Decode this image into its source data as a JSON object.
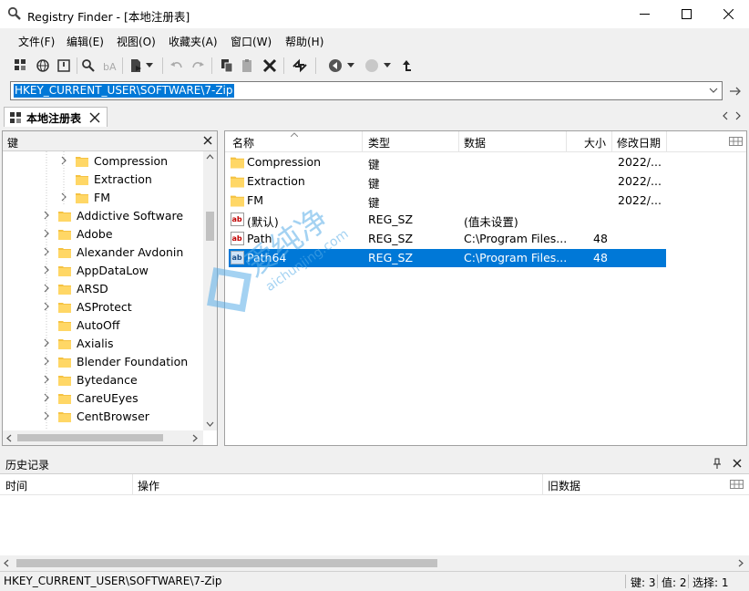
{
  "window": {
    "title": "Registry Finder - [本地注册表]"
  },
  "menu": [
    {
      "label": "文件(F)"
    },
    {
      "label": "编辑(E)"
    },
    {
      "label": "视图(O)"
    },
    {
      "label": "收藏夹(A)"
    },
    {
      "label": "窗口(W)"
    },
    {
      "label": "帮助(H)"
    }
  ],
  "address": {
    "value": "HKEY_CURRENT_USER\\SOFTWARE\\7-Zip"
  },
  "tabs": [
    {
      "label": "本地注册表"
    }
  ],
  "tree": {
    "header": "键",
    "items": [
      {
        "label": "Compression",
        "arrow": true
      },
      {
        "label": "Extraction",
        "arrow": false
      },
      {
        "label": "FM",
        "arrow": true
      },
      {
        "label": "Addictive Software",
        "arrow": true
      },
      {
        "label": "Adobe",
        "arrow": true
      },
      {
        "label": "Alexander Avdonin",
        "arrow": true
      },
      {
        "label": "AppDataLow",
        "arrow": true
      },
      {
        "label": "ARSD",
        "arrow": true
      },
      {
        "label": "ASProtect",
        "arrow": true
      },
      {
        "label": "AutoOff",
        "arrow": false
      },
      {
        "label": "Axialis",
        "arrow": true
      },
      {
        "label": "Blender Foundation",
        "arrow": true
      },
      {
        "label": "Bytedance",
        "arrow": true
      },
      {
        "label": "CareUEyes",
        "arrow": true
      },
      {
        "label": "CentBrowser",
        "arrow": true
      }
    ]
  },
  "list": {
    "columns": {
      "name": "名称",
      "type": "类型",
      "data": "数据",
      "size": "大小",
      "modified": "修改日期"
    },
    "rows": [
      {
        "icon": "folder-icon",
        "name": "Compression",
        "type": "键",
        "data": "",
        "size": "",
        "modified": "2022/..."
      },
      {
        "icon": "folder-icon",
        "name": "Extraction",
        "type": "键",
        "data": "",
        "size": "",
        "modified": "2022/..."
      },
      {
        "icon": "folder-icon",
        "name": "FM",
        "type": "键",
        "data": "",
        "size": "",
        "modified": "2022/..."
      },
      {
        "icon": "string-value-icon",
        "name": "(默认)",
        "type": "REG_SZ",
        "data": "(值未设置)",
        "size": "",
        "modified": ""
      },
      {
        "icon": "string-value-icon",
        "name": "Path",
        "type": "REG_SZ",
        "data": "C:\\Program Files...",
        "size": "48",
        "modified": ""
      },
      {
        "icon": "string-value-icon",
        "name": "Path64",
        "type": "REG_SZ",
        "data": "C:\\Program Files...",
        "size": "48",
        "modified": "",
        "selected": true
      }
    ]
  },
  "history": {
    "title": "历史记录",
    "columns": {
      "time": "时间",
      "action": "操作",
      "old_data": "旧数据"
    }
  },
  "status": {
    "path": "HKEY_CURRENT_USER\\SOFTWARE\\7-Zip",
    "keys": "键: 3",
    "values": "值: 2",
    "selected": "选择: 1"
  },
  "colors": {
    "selection": "#0078d7",
    "folder": "#f5c242"
  }
}
